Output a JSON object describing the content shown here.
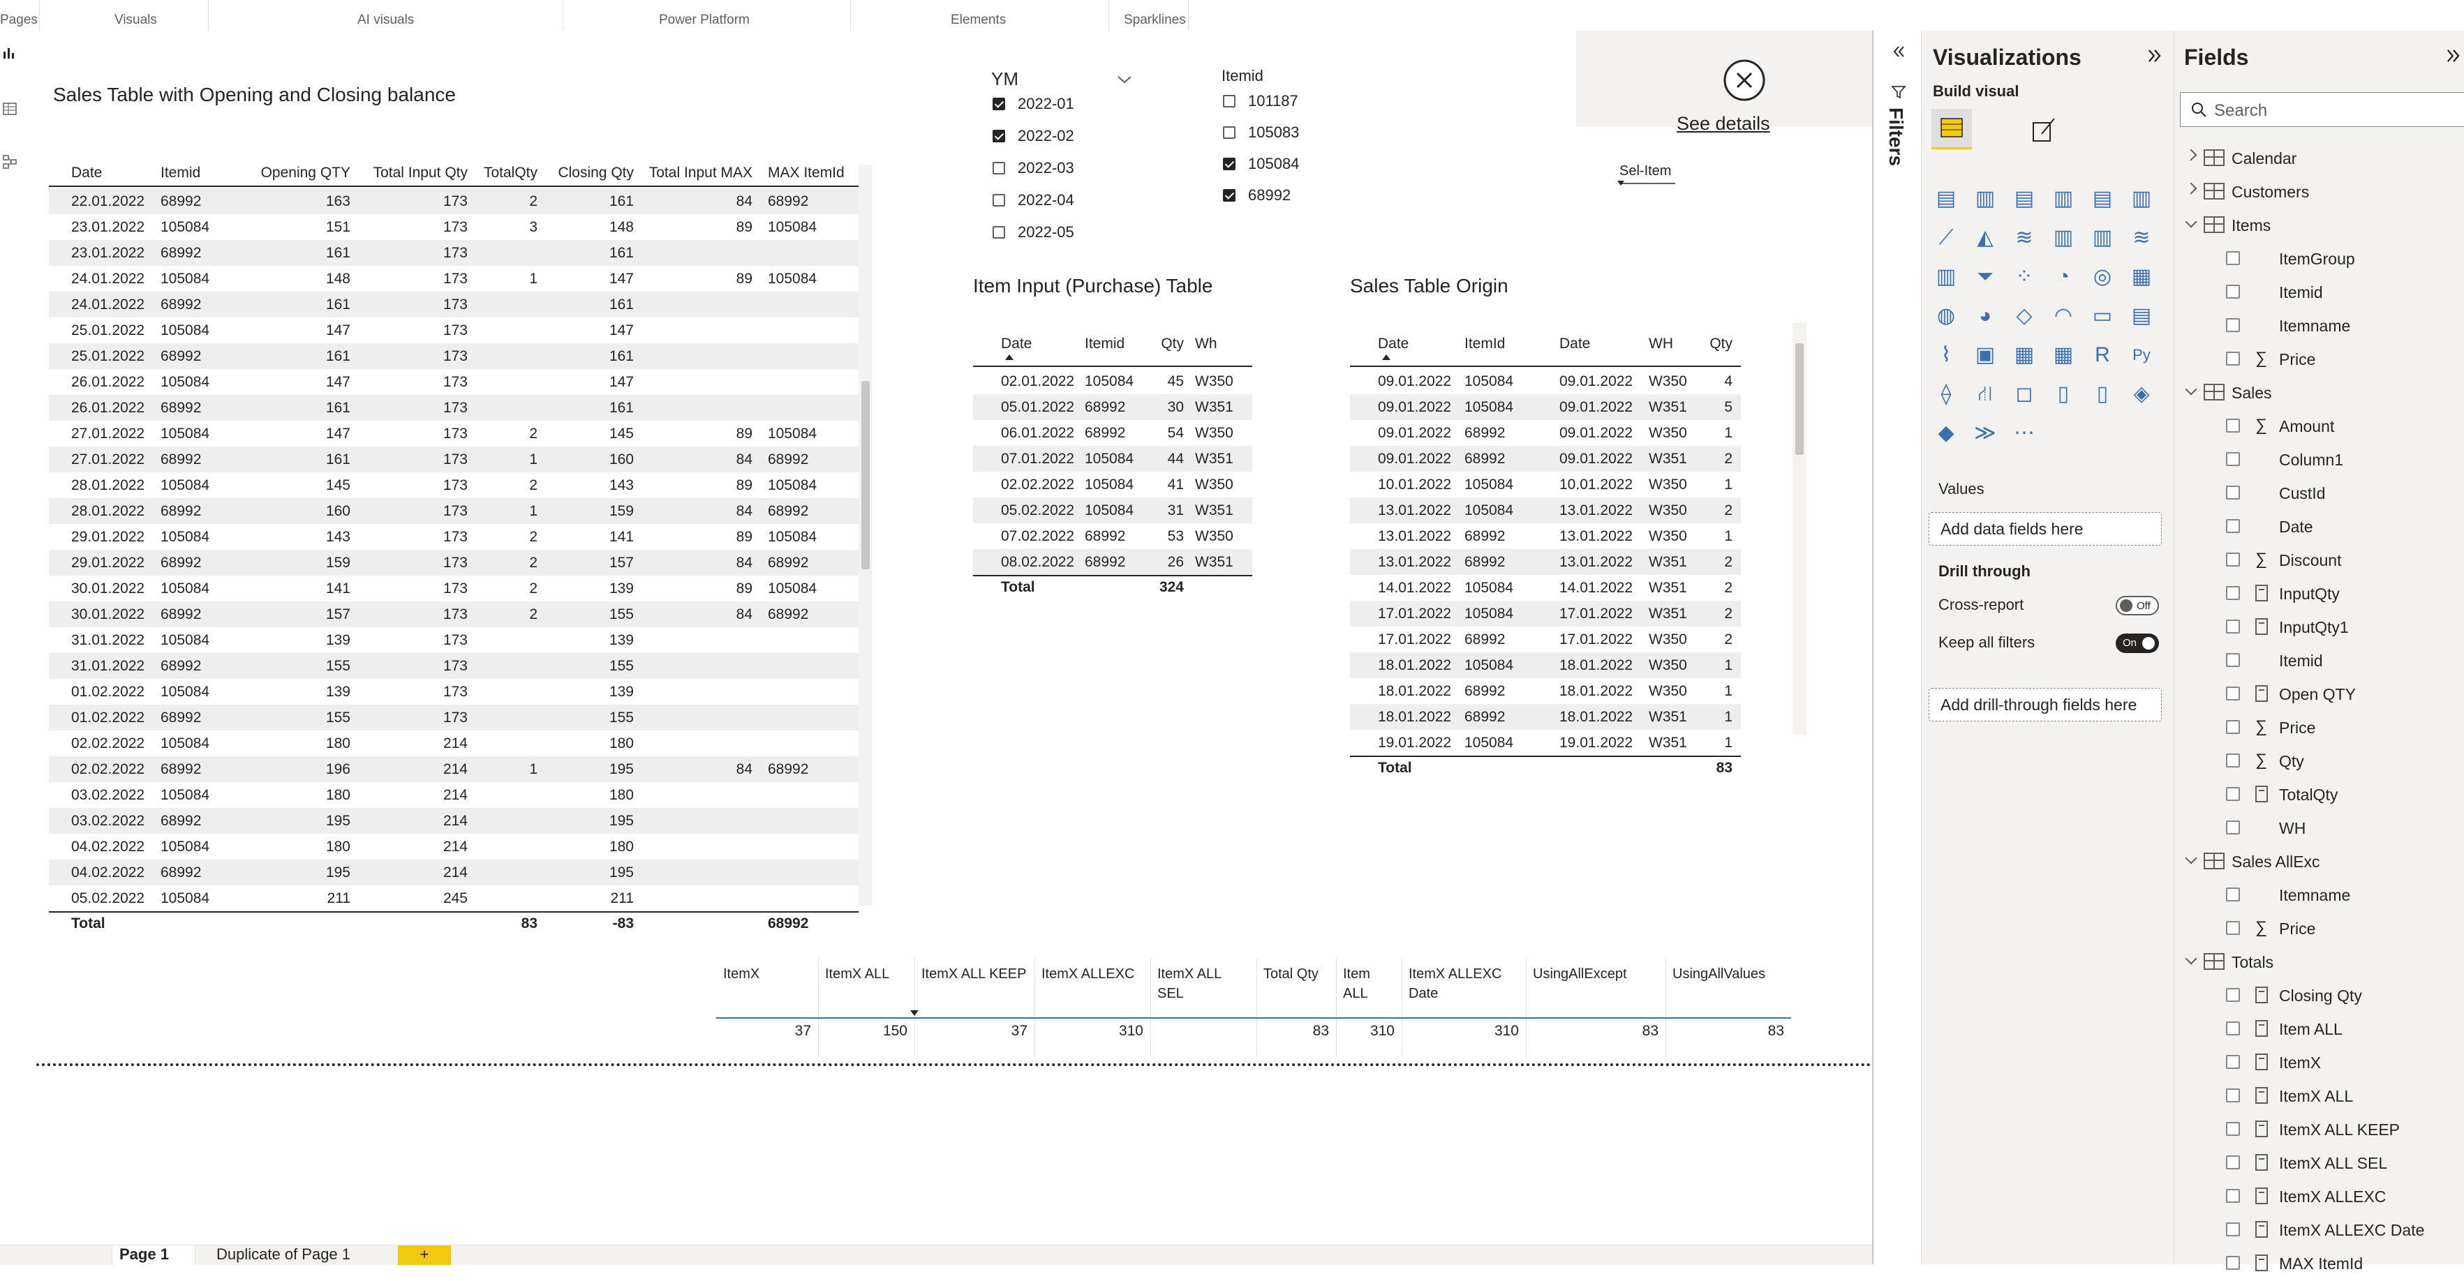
{
  "ribbon": {
    "sections": [
      "Pages",
      "Visuals",
      "AI visuals",
      "Power Platform",
      "Elements",
      "Sparklines"
    ]
  },
  "sales_table": {
    "title": "Sales Table with Opening and Closing balance",
    "columns": [
      "Date",
      "Itemid",
      "Opening QTY",
      "Total Input Qty",
      "TotalQty",
      "Closing Qty",
      "Total Input MAX",
      "MAX ItemId"
    ],
    "rows": [
      [
        "22.01.2022",
        "68992",
        "163",
        "173",
        "2",
        "161",
        "84",
        "68992"
      ],
      [
        "23.01.2022",
        "105084",
        "151",
        "173",
        "3",
        "148",
        "89",
        "105084"
      ],
      [
        "23.01.2022",
        "68992",
        "161",
        "173",
        "",
        "161",
        "",
        ""
      ],
      [
        "24.01.2022",
        "105084",
        "148",
        "173",
        "1",
        "147",
        "89",
        "105084"
      ],
      [
        "24.01.2022",
        "68992",
        "161",
        "173",
        "",
        "161",
        "",
        ""
      ],
      [
        "25.01.2022",
        "105084",
        "147",
        "173",
        "",
        "147",
        "",
        ""
      ],
      [
        "25.01.2022",
        "68992",
        "161",
        "173",
        "",
        "161",
        "",
        ""
      ],
      [
        "26.01.2022",
        "105084",
        "147",
        "173",
        "",
        "147",
        "",
        ""
      ],
      [
        "26.01.2022",
        "68992",
        "161",
        "173",
        "",
        "161",
        "",
        ""
      ],
      [
        "27.01.2022",
        "105084",
        "147",
        "173",
        "2",
        "145",
        "89",
        "105084"
      ],
      [
        "27.01.2022",
        "68992",
        "161",
        "173",
        "1",
        "160",
        "84",
        "68992"
      ],
      [
        "28.01.2022",
        "105084",
        "145",
        "173",
        "2",
        "143",
        "89",
        "105084"
      ],
      [
        "28.01.2022",
        "68992",
        "160",
        "173",
        "1",
        "159",
        "84",
        "68992"
      ],
      [
        "29.01.2022",
        "105084",
        "143",
        "173",
        "2",
        "141",
        "89",
        "105084"
      ],
      [
        "29.01.2022",
        "68992",
        "159",
        "173",
        "2",
        "157",
        "84",
        "68992"
      ],
      [
        "30.01.2022",
        "105084",
        "141",
        "173",
        "2",
        "139",
        "89",
        "105084"
      ],
      [
        "30.01.2022",
        "68992",
        "157",
        "173",
        "2",
        "155",
        "84",
        "68992"
      ],
      [
        "31.01.2022",
        "105084",
        "139",
        "173",
        "",
        "139",
        "",
        ""
      ],
      [
        "31.01.2022",
        "68992",
        "155",
        "173",
        "",
        "155",
        "",
        ""
      ],
      [
        "01.02.2022",
        "105084",
        "139",
        "173",
        "",
        "139",
        "",
        ""
      ],
      [
        "01.02.2022",
        "68992",
        "155",
        "173",
        "",
        "155",
        "",
        ""
      ],
      [
        "02.02.2022",
        "105084",
        "180",
        "214",
        "",
        "180",
        "",
        ""
      ],
      [
        "02.02.2022",
        "68992",
        "196",
        "214",
        "1",
        "195",
        "84",
        "68992"
      ],
      [
        "03.02.2022",
        "105084",
        "180",
        "214",
        "",
        "180",
        "",
        ""
      ],
      [
        "03.02.2022",
        "68992",
        "195",
        "214",
        "",
        "195",
        "",
        ""
      ],
      [
        "04.02.2022",
        "105084",
        "180",
        "214",
        "",
        "180",
        "",
        ""
      ],
      [
        "04.02.2022",
        "68992",
        "195",
        "214",
        "",
        "195",
        "",
        ""
      ],
      [
        "05.02.2022",
        "105084",
        "211",
        "245",
        "",
        "211",
        "",
        ""
      ]
    ],
    "total": [
      "Total",
      "",
      "",
      "",
      "83",
      "-83",
      "",
      "68992"
    ]
  },
  "slicer_ym": {
    "title": "YM",
    "items": [
      {
        "label": "2022-01",
        "checked": true
      },
      {
        "label": "2022-02",
        "checked": true
      },
      {
        "label": "2022-03",
        "checked": false
      },
      {
        "label": "2022-04",
        "checked": false
      },
      {
        "label": "2022-05",
        "checked": false
      }
    ]
  },
  "slicer_itemid": {
    "title": "Itemid",
    "items": [
      {
        "label": "101187",
        "checked": false
      },
      {
        "label": "105083",
        "checked": false
      },
      {
        "label": "105084",
        "checked": true
      },
      {
        "label": "68992",
        "checked": true
      }
    ]
  },
  "see_details": {
    "label": "See details"
  },
  "sel_item": {
    "label": "Sel-Item"
  },
  "input_table": {
    "title": "Item Input (Purchase)  Table",
    "columns": [
      "Date",
      "Itemid",
      "Qty",
      "Wh"
    ],
    "rows": [
      [
        "02.01.2022",
        "105084",
        "45",
        "W350"
      ],
      [
        "05.01.2022",
        "68992",
        "30",
        "W351"
      ],
      [
        "06.01.2022",
        "68992",
        "54",
        "W350"
      ],
      [
        "07.01.2022",
        "105084",
        "44",
        "W351"
      ],
      [
        "02.02.2022",
        "105084",
        "41",
        "W350"
      ],
      [
        "05.02.2022",
        "105084",
        "31",
        "W351"
      ],
      [
        "07.02.2022",
        "68992",
        "53",
        "W350"
      ],
      [
        "08.02.2022",
        "68992",
        "26",
        "W351"
      ]
    ],
    "total": [
      "Total",
      "",
      "324",
      ""
    ]
  },
  "origin_table": {
    "title": "Sales Table Origin",
    "columns": [
      "Date",
      "ItemId",
      "Date",
      "WH",
      "Qty"
    ],
    "rows": [
      [
        "09.01.2022",
        "105084",
        "09.01.2022",
        "W350",
        "4"
      ],
      [
        "09.01.2022",
        "105084",
        "09.01.2022",
        "W351",
        "5"
      ],
      [
        "09.01.2022",
        "68992",
        "09.01.2022",
        "W350",
        "1"
      ],
      [
        "09.01.2022",
        "68992",
        "09.01.2022",
        "W351",
        "2"
      ],
      [
        "10.01.2022",
        "105084",
        "10.01.2022",
        "W350",
        "1"
      ],
      [
        "13.01.2022",
        "105084",
        "13.01.2022",
        "W350",
        "2"
      ],
      [
        "13.01.2022",
        "68992",
        "13.01.2022",
        "W350",
        "1"
      ],
      [
        "13.01.2022",
        "68992",
        "13.01.2022",
        "W351",
        "2"
      ],
      [
        "14.01.2022",
        "105084",
        "14.01.2022",
        "W351",
        "2"
      ],
      [
        "17.01.2022",
        "105084",
        "17.01.2022",
        "W351",
        "2"
      ],
      [
        "17.01.2022",
        "68992",
        "17.01.2022",
        "W350",
        "2"
      ],
      [
        "18.01.2022",
        "105084",
        "18.01.2022",
        "W350",
        "1"
      ],
      [
        "18.01.2022",
        "68992",
        "18.01.2022",
        "W350",
        "1"
      ],
      [
        "18.01.2022",
        "68992",
        "18.01.2022",
        "W351",
        "1"
      ],
      [
        "19.01.2022",
        "105084",
        "19.01.2022",
        "W351",
        "1"
      ]
    ],
    "total": [
      "Total",
      "",
      "",
      "",
      "83"
    ]
  },
  "measures_table": {
    "columns": [
      "ItemX",
      "ItemX ALL",
      "ItemX ALL KEEP",
      "ItemX ALLEXC",
      "ItemX ALL SEL",
      "Total Qty",
      "Item ALL",
      "ItemX ALLEXC Date",
      "UsingAllExcept",
      "UsingAllValues"
    ],
    "values": [
      "37",
      "150",
      "37",
      "310",
      "",
      "83",
      "310",
      "310",
      "83",
      "83"
    ]
  },
  "filters_pane": {
    "label": "Filters"
  },
  "visualizations_pane": {
    "title": "Visualizations",
    "build_visual": "Build visual",
    "values_label": "Values",
    "add_fields": "Add data fields here",
    "drill_through": "Drill through",
    "cross_report": "Cross-report",
    "cross_report_state": "Off",
    "keep_filters": "Keep all filters",
    "keep_filters_state": "On",
    "add_drill": "Add drill-through fields here"
  },
  "fields_pane": {
    "title": "Fields",
    "search_placeholder": "Search",
    "tables": [
      {
        "name": "Calendar",
        "expanded": false,
        "fields": []
      },
      {
        "name": "Customers",
        "expanded": false,
        "fields": []
      },
      {
        "name": "Items",
        "expanded": true,
        "fields": [
          {
            "name": "ItemGroup",
            "kind": "col"
          },
          {
            "name": "Itemid",
            "kind": "col"
          },
          {
            "name": "Itemname",
            "kind": "col"
          },
          {
            "name": "Price",
            "kind": "sum"
          }
        ]
      },
      {
        "name": "Sales",
        "expanded": true,
        "fields": [
          {
            "name": "Amount",
            "kind": "sum"
          },
          {
            "name": "Column1",
            "kind": "col"
          },
          {
            "name": "CustId",
            "kind": "col"
          },
          {
            "name": "Date",
            "kind": "col"
          },
          {
            "name": "Discount",
            "kind": "sum"
          },
          {
            "name": "InputQty",
            "kind": "measure"
          },
          {
            "name": "InputQty1",
            "kind": "measure"
          },
          {
            "name": "Itemid",
            "kind": "col"
          },
          {
            "name": "Open QTY",
            "kind": "measure"
          },
          {
            "name": "Price",
            "kind": "sum"
          },
          {
            "name": "Qty",
            "kind": "sum"
          },
          {
            "name": "TotalQty",
            "kind": "measure"
          },
          {
            "name": "WH",
            "kind": "col"
          }
        ]
      },
      {
        "name": "Sales AllExc",
        "expanded": true,
        "fields": [
          {
            "name": "Itemname",
            "kind": "col"
          },
          {
            "name": "Price",
            "kind": "sum"
          }
        ]
      },
      {
        "name": "Totals",
        "expanded": true,
        "fields": [
          {
            "name": "Closing Qty",
            "kind": "measure"
          },
          {
            "name": "Item ALL",
            "kind": "measure"
          },
          {
            "name": "ItemX",
            "kind": "measure"
          },
          {
            "name": "ItemX ALL",
            "kind": "measure"
          },
          {
            "name": "ItemX ALL KEEP",
            "kind": "measure"
          },
          {
            "name": "ItemX ALL SEL",
            "kind": "measure"
          },
          {
            "name": "ItemX ALLEXC",
            "kind": "measure"
          },
          {
            "name": "ItemX ALLEXC Date",
            "kind": "measure"
          },
          {
            "name": "MAX ItemId",
            "kind": "measure"
          }
        ]
      }
    ]
  },
  "page_tabs": [
    "Page 1",
    "Duplicate of Page 1",
    "+"
  ]
}
